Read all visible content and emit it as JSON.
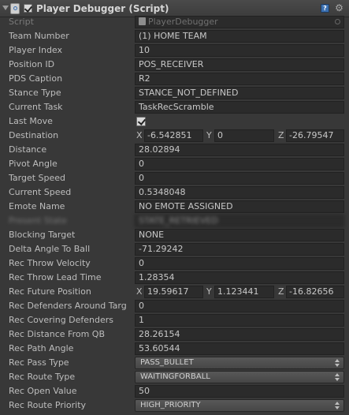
{
  "header": {
    "title": "Player Debugger (Script)",
    "help_symbol": "?",
    "gear_symbol": "⚙"
  },
  "script_row": {
    "label": "Script",
    "value": "PlayerDebugger"
  },
  "fields": [
    {
      "label": "Team Number",
      "value": "(1) HOME TEAM"
    },
    {
      "label": "Player Index",
      "value": "10"
    },
    {
      "label": "Position ID",
      "value": "POS_RECEIVER"
    },
    {
      "label": "PDS Caption",
      "value": "R2"
    },
    {
      "label": "Stance Type",
      "value": "STANCE_NOT_DEFINED"
    },
    {
      "label": "Current Task",
      "value": "TaskRecScramble"
    }
  ],
  "last_move": {
    "label": "Last Move",
    "checked": true
  },
  "destination": {
    "label": "Destination",
    "x_label": "X",
    "x": "-6.542851",
    "y_label": "Y",
    "y": "0",
    "z_label": "Z",
    "z": "-26.79547"
  },
  "fields2": [
    {
      "label": "Distance",
      "value": "28.02894"
    },
    {
      "label": "Pivot Angle",
      "value": "0"
    },
    {
      "label": "Target Speed",
      "value": "0"
    },
    {
      "label": "Current Speed",
      "value": "0.5348048"
    },
    {
      "label": "Emote Name",
      "value": "NO EMOTE ASSIGNED"
    }
  ],
  "obscured_row": {
    "label": "Present State",
    "value": "STATE_RETRIEVED"
  },
  "fields3": [
    {
      "label": "Blocking Target",
      "value": "NONE"
    },
    {
      "label": "Delta Angle To Ball",
      "value": "-71.29242"
    },
    {
      "label": "Rec Throw Velocity",
      "value": "0"
    },
    {
      "label": "Rec Throw Lead Time",
      "value": "1.28354"
    }
  ],
  "future_position": {
    "label": "Rec Future Position",
    "x_label": "X",
    "x": "19.59617",
    "y_label": "Y",
    "y": "1.123441",
    "z_label": "Z",
    "z": "-16.82656"
  },
  "fields4": [
    {
      "label": "Rec Defenders Around Targ",
      "value": "0"
    },
    {
      "label": "Rec Covering Defenders",
      "value": "1"
    },
    {
      "label": "Rec Distance From QB",
      "value": "28.26154"
    },
    {
      "label": "Rec Path Angle",
      "value": "53.60544"
    }
  ],
  "pass_type": {
    "label": "Rec Pass Type",
    "value": "PASS_BULLET"
  },
  "route_type": {
    "label": "Rec Route Type",
    "value": "WAITINGFORBALL"
  },
  "open_value": {
    "label": "Rec Open Value",
    "value": "50"
  },
  "route_priority": {
    "label": "Rec Route Priority",
    "value": "HIGH_PRIORITY"
  }
}
